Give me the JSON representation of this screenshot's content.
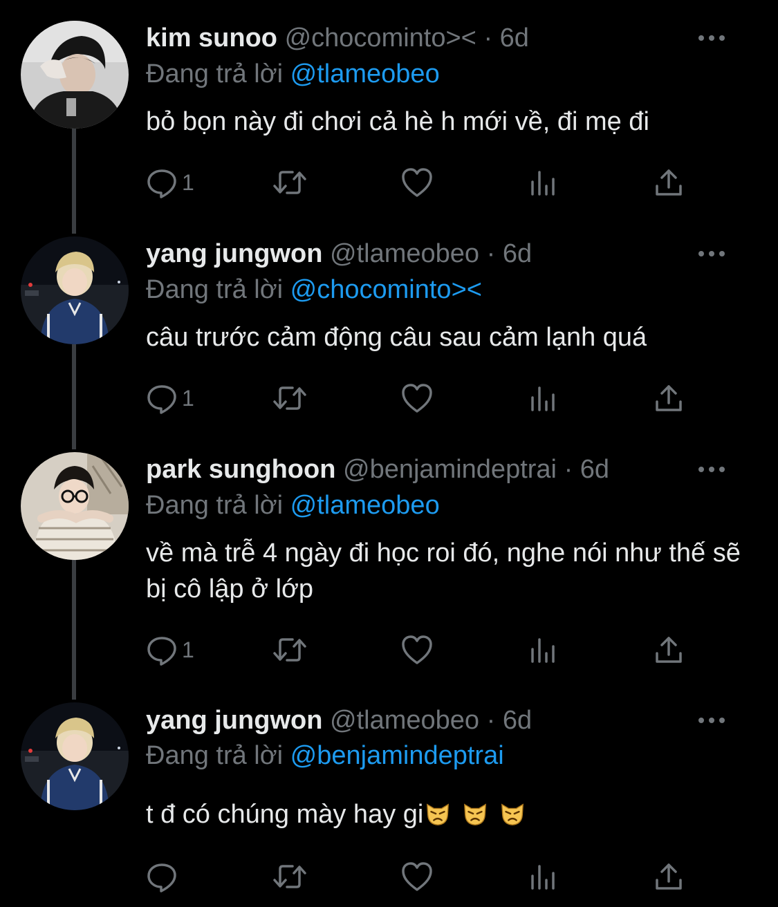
{
  "replying_prefix": "Đang trả lời",
  "colors": {
    "background": "#000000",
    "text": "#e7e9ea",
    "secondary": "#71767b",
    "mention": "#1d9bf0",
    "thread_line": "#3a3d41"
  },
  "tweets": [
    {
      "name": "kim sunoo",
      "handle": "@chocominto><",
      "dot": "·",
      "time": "6d",
      "replying_to": "@tlameobeo",
      "text": "bỏ bọn này đi chơi cả hè h mới về, đi mẹ đi",
      "reply_count": "1",
      "avatar": "avatar-dark-portrait",
      "icons": [
        "reply-icon",
        "retweet-icon",
        "like-icon",
        "views-icon",
        "share-icon",
        "more-icon"
      ]
    },
    {
      "name": "yang jungwon",
      "handle": "@tlameobeo",
      "dot": "·",
      "time": "6d",
      "replying_to": "@chocominto><",
      "text": "câu trước cảm động câu sau cảm lạnh quá",
      "reply_count": "1",
      "avatar": "avatar-night-portrait"
    },
    {
      "name": "park sunghoon",
      "handle": "@benjamindeptrai",
      "dot": "·",
      "time": "6d",
      "replying_to": "@tlameobeo",
      "text": "về mà trễ 4 ngày đi học roi đó, nghe nói như thế sẽ bị cô lập ở lớp",
      "reply_count": "1",
      "avatar": "avatar-glasses-portrait"
    },
    {
      "name": "yang jungwon",
      "handle": "@tlameobeo",
      "dot": "·",
      "time": "6d",
      "replying_to": "@benjamindeptrai",
      "text": "t đ có chúng mày hay gi",
      "reply_count": "",
      "emojis": [
        "pouting-cat-emoji",
        "pouting-cat-emoji",
        "pouting-cat-emoji"
      ],
      "avatar": "avatar-night-portrait"
    }
  ]
}
